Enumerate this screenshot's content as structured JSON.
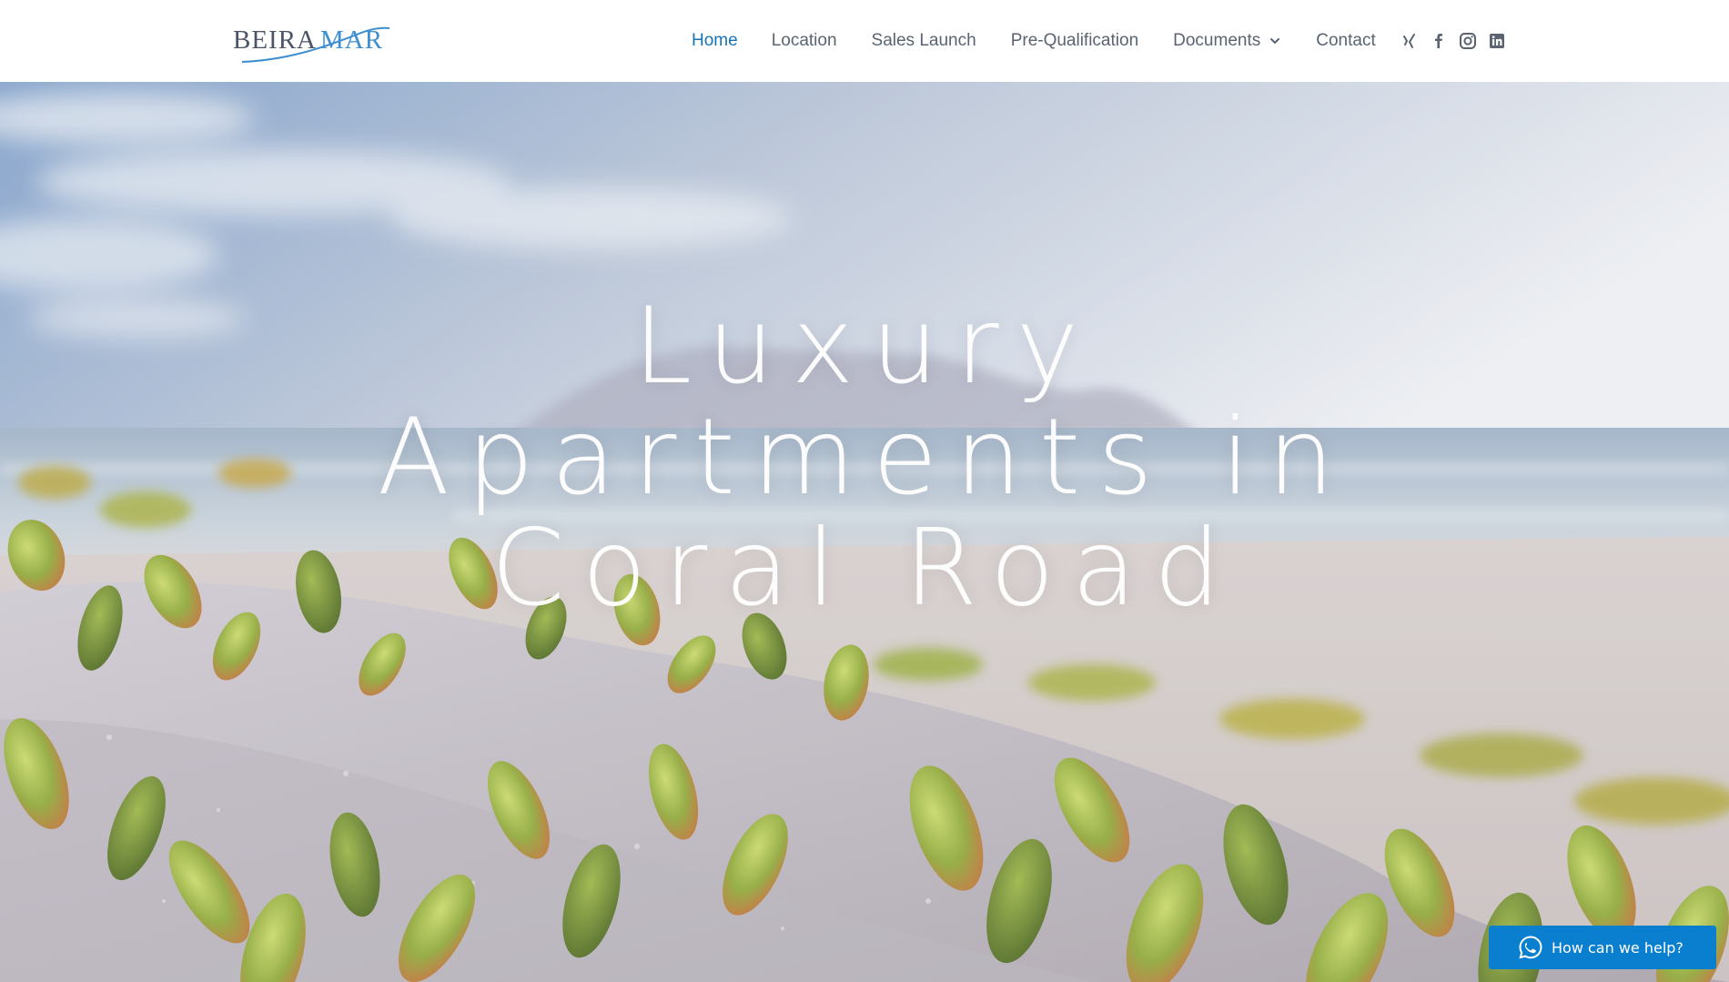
{
  "brand": {
    "logo_part1": "BEIRA",
    "logo_part2": "MAR",
    "colors": {
      "logo_grey": "#4a5568",
      "logo_blue": "#3d8fd1",
      "accent": "#1673b8",
      "chat_bg": "#0b7fcf"
    }
  },
  "nav": {
    "items": [
      {
        "label": "Home",
        "active": true
      },
      {
        "label": "Location",
        "active": false
      },
      {
        "label": "Sales Launch",
        "active": false
      },
      {
        "label": "Pre-Qualification",
        "active": false
      },
      {
        "label": "Documents",
        "active": false,
        "dropdown": true
      },
      {
        "label": "Contact",
        "active": false
      }
    ],
    "socials": [
      "xing-icon",
      "facebook-icon",
      "instagram-icon",
      "linkedin-icon"
    ]
  },
  "hero": {
    "title_lines": [
      "Luxury",
      "Apartments in",
      "Coral Road"
    ]
  },
  "chat": {
    "label": "How can we help?",
    "icon": "whatsapp-icon"
  }
}
